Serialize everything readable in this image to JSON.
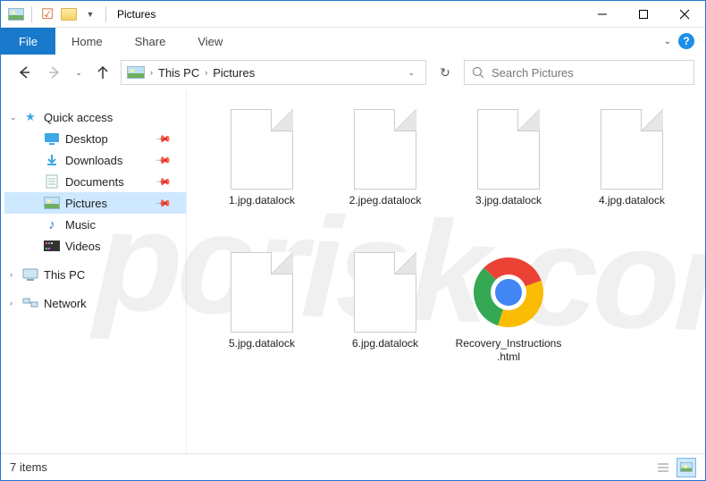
{
  "titlebar": {
    "title": "Pictures"
  },
  "ribbon": {
    "file": "File",
    "tabs": [
      "Home",
      "Share",
      "View"
    ]
  },
  "breadcrumb": {
    "root": "This PC",
    "current": "Pictures"
  },
  "search": {
    "placeholder": "Search Pictures"
  },
  "sidebar": {
    "quickAccess": "Quick access",
    "items": [
      {
        "label": "Desktop",
        "pinned": true,
        "icon": "desktop"
      },
      {
        "label": "Downloads",
        "pinned": true,
        "icon": "downloads"
      },
      {
        "label": "Documents",
        "pinned": true,
        "icon": "documents"
      },
      {
        "label": "Pictures",
        "pinned": true,
        "icon": "pictures",
        "selected": true
      },
      {
        "label": "Music",
        "pinned": false,
        "icon": "music"
      },
      {
        "label": "Videos",
        "pinned": false,
        "icon": "videos"
      }
    ],
    "thisPC": "This PC",
    "network": "Network"
  },
  "files": [
    {
      "name": "1.jpg.datalock",
      "type": "blank"
    },
    {
      "name": "2.jpeg.datalock",
      "type": "blank"
    },
    {
      "name": "3.jpg.datalock",
      "type": "blank"
    },
    {
      "name": "4.jpg.datalock",
      "type": "blank"
    },
    {
      "name": "5.jpg.datalock",
      "type": "blank"
    },
    {
      "name": "6.jpg.datalock",
      "type": "blank"
    },
    {
      "name": "Recovery_Instructions.html",
      "type": "chrome"
    }
  ],
  "status": {
    "text": "7 items"
  },
  "watermark": "pcrisk.com"
}
